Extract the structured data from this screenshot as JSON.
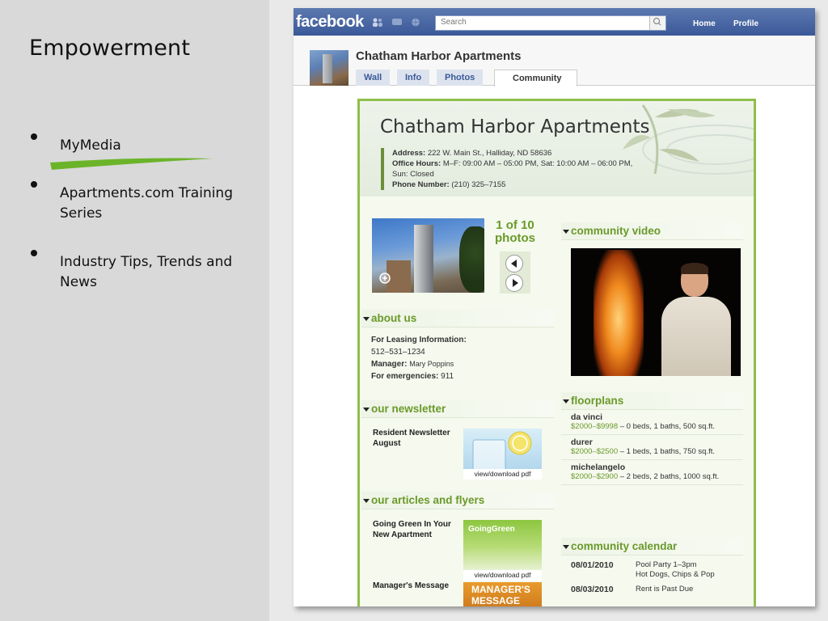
{
  "slide": {
    "title": "Empowerment",
    "bullets": [
      {
        "label": "MyMedia"
      },
      {
        "label": "Apartments.com Training Series"
      },
      {
        "label": "Industry Tips, Trends and News"
      }
    ],
    "accent_color": "#6bb42a"
  },
  "facebook": {
    "logo": "facebook",
    "search_placeholder": "Search",
    "nav": {
      "home": "Home",
      "profile": "Profile"
    },
    "brand_color": "#3b5998"
  },
  "page": {
    "name": "Chatham Harbor Apartments",
    "tabs": [
      {
        "label": "Wall"
      },
      {
        "label": "Info"
      },
      {
        "label": "Photos"
      },
      {
        "label": "Community",
        "active": true
      }
    ]
  },
  "widget": {
    "title": "Chatham Harbor Apartments",
    "address_label": "Address:",
    "address": "222 W. Main St., Halliday, ND 58636",
    "hours_label": "Office Hours:",
    "hours": "M–F: 09:00 AM – 05:00 PM, Sat: 10:00 AM – 06:00 PM, Sun: Closed",
    "phone_label": "Phone Number:",
    "phone": "(210) 325–7155",
    "gallery": {
      "count_line1": "1 of 10",
      "count_line2": "photos"
    },
    "about": {
      "heading": "about us",
      "leasing_label": "For Leasing Information:",
      "leasing_phone": "512–531–1234",
      "manager_label": "Manager:",
      "manager_name": "Mary Poppins",
      "emergency_label": "For emergencies:",
      "emergency_number": "911"
    },
    "newsletter": {
      "heading": "our newsletter",
      "item_title": "Resident Newsletter August",
      "download_label": "view/download pdf"
    },
    "articles": {
      "heading": "our articles and flyers",
      "items": [
        {
          "title": "Going Green In Your New Apartment",
          "thumb_text": "GoingGreen",
          "download_label": "view/download pdf"
        },
        {
          "title": "Manager's Message",
          "thumb_text": "MANAGER'S MESSAGE"
        }
      ]
    },
    "video": {
      "heading": "community video"
    },
    "floorplans": {
      "heading": "floorplans",
      "items": [
        {
          "name": "da vinci",
          "price": "$2000–$9998",
          "details": " – 0 beds, 1 baths, 500 sq.ft."
        },
        {
          "name": "durer",
          "price": "$2000–$2500",
          "details": " – 1 beds, 1 baths, 750 sq.ft."
        },
        {
          "name": "michelangelo",
          "price": "$2000–$2900",
          "details": " – 2 beds, 2 baths, 1000 sq.ft."
        }
      ]
    },
    "calendar": {
      "heading": "community calendar",
      "events": [
        {
          "date": "08/01/2010",
          "line1": "Pool Party 1–3pm",
          "line2": "Hot Dogs, Chips & Pop"
        },
        {
          "date": "08/03/2010",
          "line1": "Rent is Past Due",
          "line2": ""
        }
      ]
    }
  }
}
